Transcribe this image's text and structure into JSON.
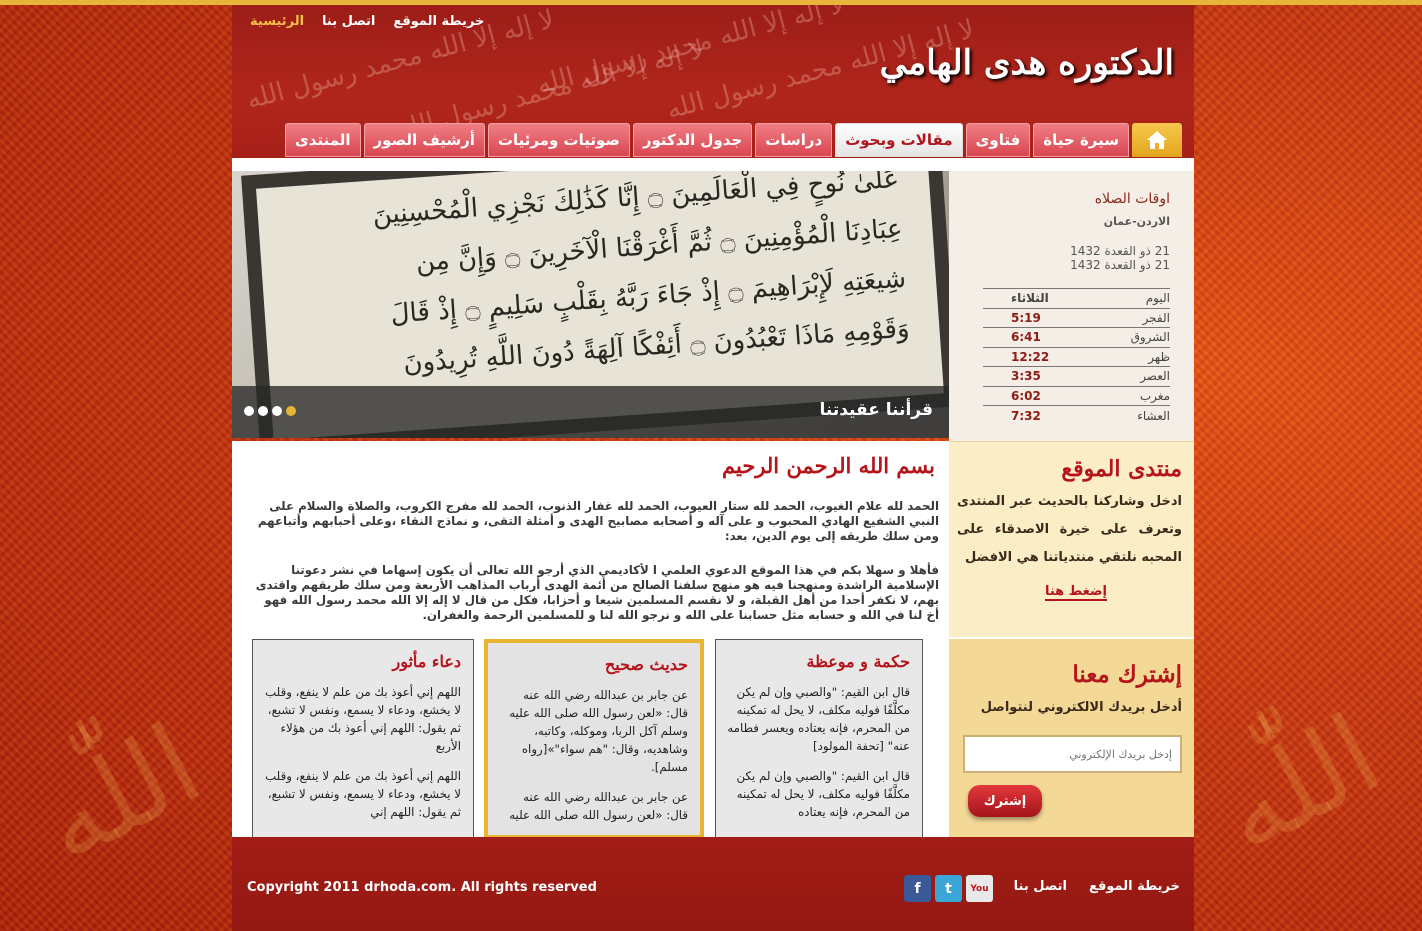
{
  "header": {
    "site_title": "الدكتوره هدى الهامي",
    "top_links": [
      "الرئيسية",
      "اتصل بنا",
      "خريطة الموقع"
    ]
  },
  "nav": {
    "items": [
      "سيرة حياة",
      "فتاوى",
      "مقالات وبحوث",
      "دراسات",
      "جدول الدكتور",
      "صوتيات ومرئيات",
      "أرشيف الصور",
      "المنتدى"
    ],
    "active": "مقالات وبحوث"
  },
  "slider": {
    "caption": "قرأننا عقيدتنا",
    "slides_count": 4,
    "active_slide": 1,
    "verses": [
      "عَلَىٰ نُوحٍ فِي الْعَالَمِينَ ۝ إِنَّا كَذَٰلِكَ نَجْزِي الْمُحْسِنِينَ",
      "عِبَادِنَا الْمُؤْمِنِينَ ۝ ثُمَّ أَغْرَقْنَا الْآخَرِينَ ۝ وَإِنَّ مِن",
      "شِيعَتِهِ لَإِبْرَاهِيمَ ۝ إِذْ جَاءَ رَبَّهُ بِقَلْبٍ سَلِيمٍ ۝ إِذْ قَالَ",
      "وَقَوْمِهِ مَاذَا تَعْبُدُونَ ۝ أَئِفْكًا آلِهَةً دُونَ اللَّهِ تُرِيدُونَ"
    ]
  },
  "prayer": {
    "title": "اوقات الصلاه",
    "location": "الاردن-عمان",
    "dates": [
      "21 ذو القعدة 1432",
      "21 ذو القعدة 1432"
    ],
    "rows": [
      {
        "name": "اليوم",
        "value": "الثلاثاء"
      },
      {
        "name": "الفجر",
        "value": "5:19"
      },
      {
        "name": "الشروق",
        "value": "6:41"
      },
      {
        "name": "ظهر",
        "value": "12:22"
      },
      {
        "name": "العصر",
        "value": "3:35"
      },
      {
        "name": "مغرب",
        "value": "6:02"
      },
      {
        "name": "العشاء",
        "value": "7:32"
      }
    ]
  },
  "main": {
    "heading": "بسم الله الرحمن الرحيم",
    "paragraph1": "الحمد لله علام الغيوب، الحمد لله ستار العيوب، الحمد لله غفار الذنوب، الحمد لله مفرج الكروب، والصلاة والسلام على النبي الشفيع الهادي المحبوب و على آله و أصحابه مصابيح الهدى و أمثلة التقى، و نماذج النقاء ،وعلى أحبابهم وأتباعهم ومن سلك طريقه إلى يوم الدين، بعد:",
    "paragraph2": "فأهلا و سهلا بكم في هذا الموقع الدعوي العلمي ا لأكاديمي الذي أرجو الله تعالى أن يكون إسهاما في نشر دعوتنا الإسلامية الراشدة ومنهجنا فيه هو منهج سلفنا الصالح من أئمة الهدى أرباب المذاهب الأربعة ومن سلك طريقهم واقتدى بهم، لا نكفر أحدا من أهل القبلة، و لا نقسم المسلمين شيعا و أحزابا، فكل من قال لا إله إلا الله محمد رسول الله فهو أخ لنا في الله و حسابه مثل حسابنا على الله و نرجو الله لنا و للمسلمين الرحمة والغفران."
  },
  "boxes": [
    {
      "title": "حكمة و موعظة",
      "text1": "قال ابن القيم: \"والصبي وإن لم يكن مكلَّفًا فوليه مكلف، لا يحل له تمكينه من المحرم، فإنه يعتاده ويعسر فطامه عنه\" [تحفة المولود]",
      "text2": "قال ابن القيم: \"والصبي وإن لم يكن مكلَّفًا فوليه مكلف، لا يحل له تمكينه من المحرم، فإنه يعتاده"
    },
    {
      "title": "حديث صحيح",
      "text1": "عن جابر بن عبدالله رضي الله عنه قال: «لعن رسول الله صلى الله عليه وسلم آكل الربا، وموكله، وكاتبه، وشاهديه، وقال: \"هم سواء\"»[رواه مسلم].",
      "text2": "عن جابر بن عبدالله رضي الله عنه قال: «لعن رسول الله صلى الله عليه"
    },
    {
      "title": "دعاء مأثور",
      "text1": "اللهم إني أعوذ بك من علم لا ينفع، وقلب لا يخشع، ودعاء لا يسمع، ونفس لا تشبع، ثم يقول: اللهم إني أعوذ بك من هؤلاء الأربع",
      "text2": "اللهم إني أعوذ بك من علم لا ينفع، وقلب لا يخشع، ودعاء لا يسمع، ونفس لا تشبع، ثم يقول: اللهم إني"
    }
  ],
  "forum": {
    "title": "منتدى الموقع",
    "text": "ادخل وشاركنا بالحديث عبر المنتدى وتعرف على خيرة الاصدقاء على المحبه نلتقي منتدياتنا هي الافضل",
    "link": "إضغط هنا"
  },
  "subscribe": {
    "title": "إشترك معنا",
    "desc": "أدخل بريدك الالكتروني لنتواصل",
    "placeholder": "إدخل بريدك الإلكتروني",
    "button": "إشترك"
  },
  "footer": {
    "copyright": "Copyright 2011 drhoda.com. All rights reserved",
    "links": [
      "اتصل بنا",
      "خريطة الموقع"
    ],
    "social": [
      "facebook-icon",
      "twitter-icon",
      "youtube-icon"
    ]
  },
  "colors": {
    "accent_red": "#b5141b",
    "gold": "#e7b532",
    "nav_pink": "#d94651"
  }
}
